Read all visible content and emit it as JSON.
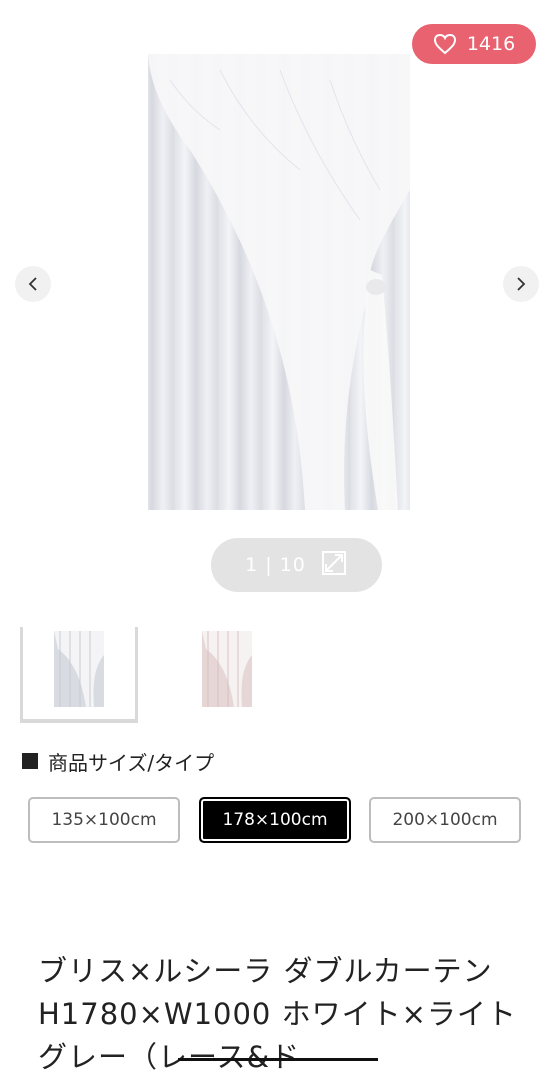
{
  "gallery": {
    "favorite_count": "1416",
    "counter_text": "1 | 10",
    "prev_icon": "chevron-left-icon",
    "next_icon": "chevron-right-icon",
    "favorite_icon": "heart-icon",
    "expand_icon": "expand-icon",
    "colors": {
      "favorite_bg": "#e8626f",
      "counter_bg": "#e3e3e3"
    }
  },
  "thumbnails": [
    {
      "name": "white-light-gray"
    },
    {
      "name": "pink"
    }
  ],
  "size_section": {
    "heading": "商品サイズ/タイプ",
    "options": [
      "135×100cm",
      "178×100cm",
      "200×100cm"
    ],
    "selected": "178×100cm"
  },
  "product": {
    "title": "ブリス×ルシーラ ダブルカーテン H1780×W1000 ホワイト×ライトグレー（レース&ド"
  }
}
